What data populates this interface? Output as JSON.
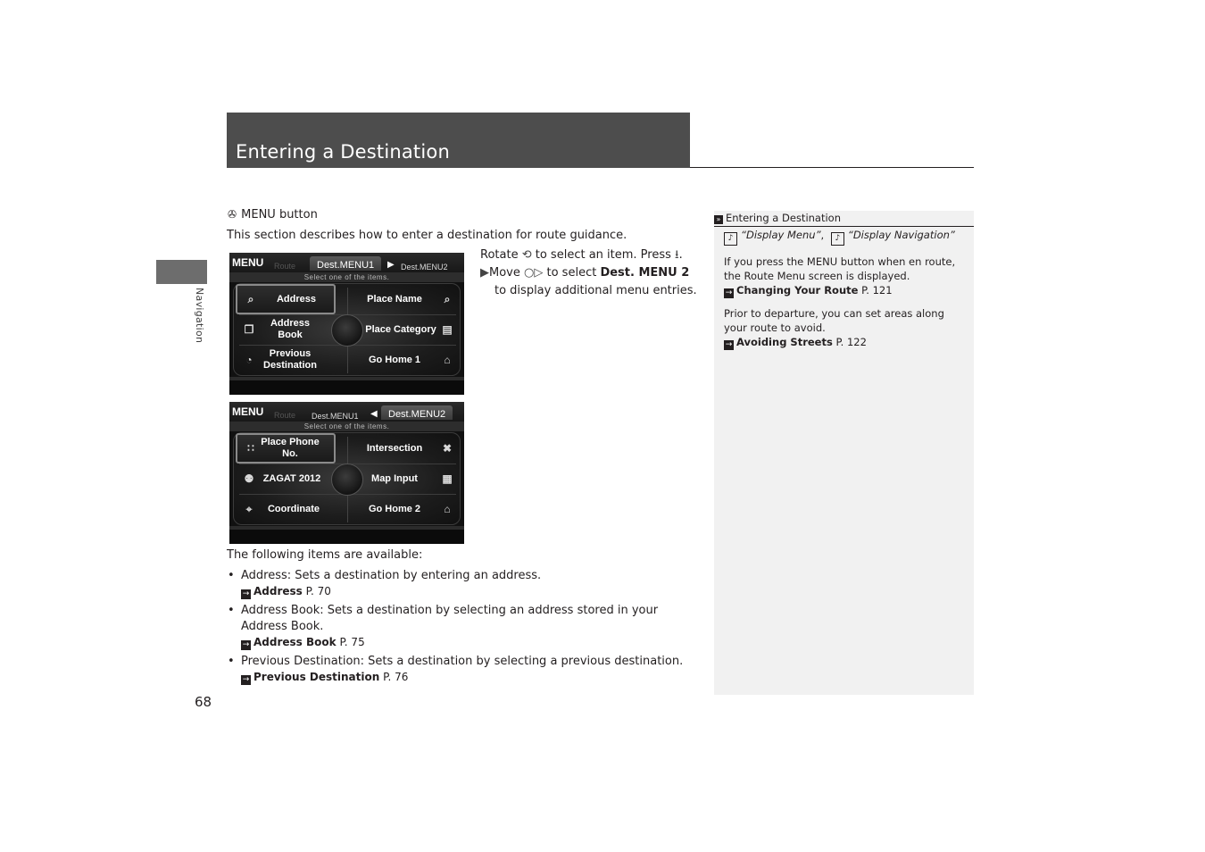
{
  "header": {
    "title": "Entering a Destination"
  },
  "side_tab": {
    "label": "Navigation"
  },
  "page_number": "68",
  "main": {
    "menu_button": {
      "icon": "menu-button-icon",
      "glyph": "✇",
      "label": "MENU button"
    },
    "intro": "This section describes how to enter a destination for route guidance.",
    "screens": [
      {
        "menu_label": "MENU",
        "route_tab": "Route",
        "tabs": [
          {
            "label": "Dest.MENU1",
            "active": true
          },
          {
            "label": "Dest.MENU2",
            "active": false
          }
        ],
        "arrow": "▶",
        "subtitle": "Select one of the items.",
        "left_items": [
          {
            "label": "Address",
            "icon": "magnifier-map-icon",
            "glyph": "⌕",
            "selected": true
          },
          {
            "label": "Address Book",
            "icon": "book-icon",
            "glyph": "❐",
            "selected": false
          },
          {
            "label": "Previous Destination",
            "icon": "history-icon",
            "glyph": "◔",
            "selected": false
          }
        ],
        "right_items": [
          {
            "label": "Place Name",
            "icon": "magnifier-icon",
            "glyph": "⌕"
          },
          {
            "label": "Place Category",
            "icon": "category-icon",
            "glyph": "▤"
          },
          {
            "label": "Go Home 1",
            "icon": "home-icon",
            "glyph": "⌂"
          }
        ]
      },
      {
        "menu_label": "MENU",
        "route_tab": "Route",
        "tabs": [
          {
            "label": "Dest.MENU1",
            "active": false
          },
          {
            "label": "Dest.MENU2",
            "active": true
          }
        ],
        "arrow": "◀",
        "subtitle": "Select one of the items.",
        "left_items": [
          {
            "label": "Place Phone No.",
            "icon": "keypad-icon",
            "glyph": "∷",
            "selected": true
          },
          {
            "label": "ZAGAT 2012",
            "icon": "zagat-icon",
            "glyph": "⚉",
            "selected": false
          },
          {
            "label": "Coordinate",
            "icon": "coordinate-icon",
            "glyph": "⌖",
            "selected": false
          }
        ],
        "right_items": [
          {
            "label": "Intersection",
            "icon": "intersection-icon",
            "glyph": "✖"
          },
          {
            "label": "Map Input",
            "icon": "map-icon",
            "glyph": "▦"
          },
          {
            "label": "Go Home 2",
            "icon": "home-icon",
            "glyph": "⌂"
          }
        ]
      }
    ],
    "instructions": {
      "rotate_pre": "Rotate",
      "rotate_icon": "⟲",
      "rotate_post": "to select an item. Press",
      "press_icon": "⭳",
      "press_post": ".",
      "sub_arrow": "▶",
      "move_pre": "Move",
      "move_icon": "○▷",
      "move_mid": "to select",
      "move_target": "Dest. MENU 2",
      "move_post": "to display additional menu entries."
    },
    "available_label": "The following items are available:",
    "items": [
      {
        "term": "Address",
        "desc": ": Sets a destination by entering an address.",
        "xref_title": "Address",
        "xref_page": "P. 70"
      },
      {
        "term": "Address Book",
        "desc": ": Sets a destination by selecting an address stored in your Address Book.",
        "xref_title": "Address Book",
        "xref_page": "P. 75"
      },
      {
        "term": "Previous Destination",
        "desc": ": Sets a destination by selecting a previous destination.",
        "xref_title": "Previous Destination",
        "xref_page": "P. 76"
      }
    ]
  },
  "sidebar": {
    "heading_icon": "»",
    "heading": "Entering a Destination",
    "voice_icon": "voice-command-icon",
    "voice_glyph": "♪",
    "voice_cmd_1": "“Display Menu”",
    "separator": ",",
    "voice_cmd_2": "“Display Navigation”",
    "paragraphs": [
      {
        "text": "If you press the MENU button when en route, the Route Menu screen is displayed.",
        "xref_title": "Changing Your Route",
        "xref_page": "P. 121"
      },
      {
        "text": "Prior to departure, you can set areas along your route to avoid.",
        "xref_title": "Avoiding Streets",
        "xref_page": "P. 122"
      }
    ]
  },
  "xref_arrow": "→",
  "bullet": "•"
}
